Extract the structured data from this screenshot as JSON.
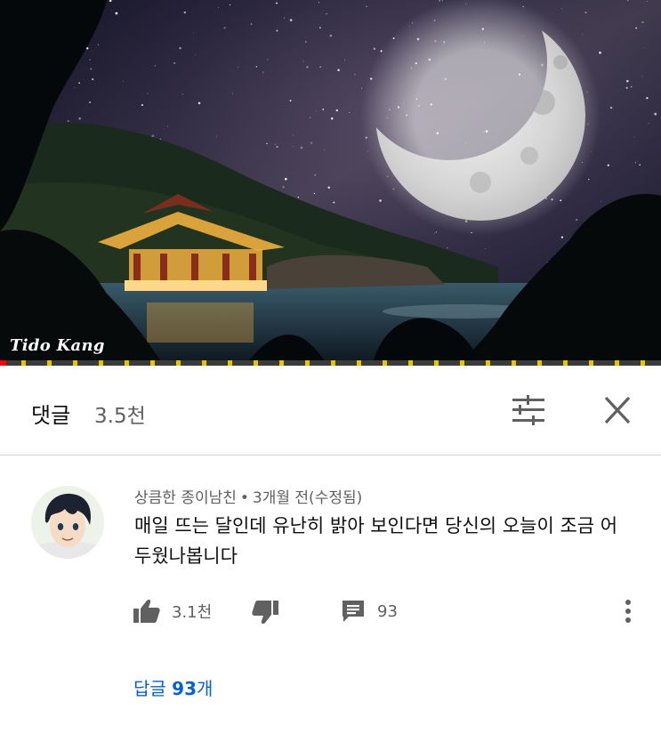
{
  "video": {
    "watermark": "Tido Kang",
    "progress_fraction": 0.01,
    "colors": {
      "progress_played": "#ff0000",
      "progress_ads": "#e8c400"
    }
  },
  "comments_header": {
    "title": "댓글",
    "count": "3.5천",
    "sort_icon": "sort-sliders-icon",
    "close_icon": "close-icon"
  },
  "comment": {
    "author": "상큼한 종이남친",
    "separator": "•",
    "time": "3개월 전(수정됨)",
    "text": "매일 뜨는 달인데 유난히 밝아 보인다면 당신의 오늘이 조금 어두웠나봅니다",
    "likes": "3.1천",
    "replies_count": "93",
    "replies_link_prefix": "답글",
    "replies_link_count": "93",
    "replies_link_suffix": "개",
    "colors": {
      "link": "#065fd4",
      "meta": "#606060"
    }
  }
}
